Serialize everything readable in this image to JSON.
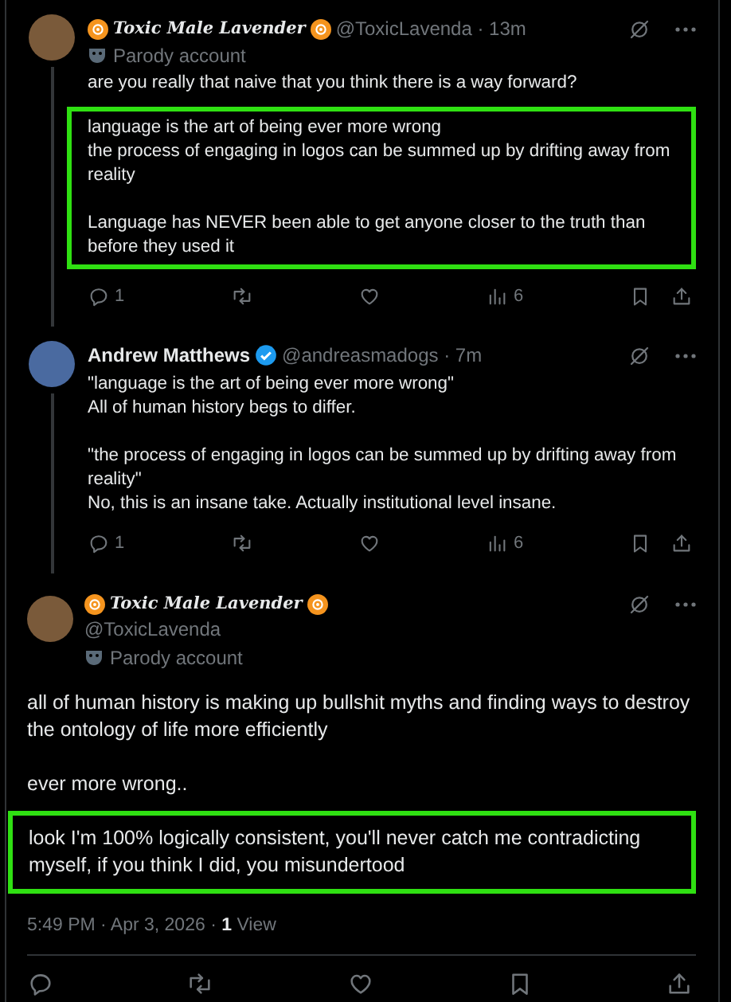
{
  "tweets": [
    {
      "kind": "thread",
      "name": "Toxic Male Lavender",
      "fancy_name": true,
      "name_badges": true,
      "verified": false,
      "byline": "@ToxicLavenda · 13m",
      "parody": "Parody account",
      "blocks": [
        {
          "highlighted": false,
          "text": "are you really that naive that you think there is a way forward?"
        },
        {
          "highlighted": true,
          "text": "language is the art of being ever more wrong\nthe process of engaging in logos can be summed up by drifting away from reality\n\nLanguage has NEVER been able to get anyone closer to the truth than before they used it"
        }
      ],
      "actions": [
        {
          "kind": "reply",
          "count": "1"
        },
        {
          "kind": "repost"
        },
        {
          "kind": "like"
        },
        {
          "kind": "views",
          "count": "6"
        },
        {
          "kind": "bookmark"
        },
        {
          "kind": "share"
        }
      ]
    },
    {
      "kind": "thread",
      "name": "Andrew Matthews",
      "fancy_name": false,
      "name_badges": false,
      "verified": true,
      "byline": "@andreasmadogs · 7m",
      "blocks": [
        {
          "highlighted": false,
          "text": "\"language is the art of being ever more wrong\"\nAll of human history begs to differ.\n\n\"the process of engaging in logos can be summed up by drifting away from reality\"\nNo, this is an insane take. Actually institutional level insane."
        }
      ],
      "actions": [
        {
          "kind": "reply",
          "count": "1"
        },
        {
          "kind": "repost"
        },
        {
          "kind": "like"
        },
        {
          "kind": "views",
          "count": "6"
        },
        {
          "kind": "bookmark"
        },
        {
          "kind": "share"
        }
      ]
    },
    {
      "kind": "focal",
      "name": "Toxic Male Lavender",
      "fancy_name": true,
      "name_badges": true,
      "verified": false,
      "byline": "@ToxicLavenda",
      "parody": "Parody account",
      "blocks": [
        {
          "highlighted": false,
          "text": "all of human history is making up bullshit myths and finding ways to destroy the ontology of life more efficiently\n\never more wrong.."
        },
        {
          "highlighted": true,
          "text": "look I'm 100% logically consistent, you'll never catch me contradicting myself, if you think I did, you misundertood"
        }
      ],
      "meta": "5:49 PM · Apr 3, 2026 · **1** View",
      "actions": [
        {
          "kind": "reply"
        },
        {
          "kind": "repost"
        },
        {
          "kind": "like"
        },
        {
          "kind": "bookmark"
        },
        {
          "kind": "share"
        }
      ]
    }
  ]
}
